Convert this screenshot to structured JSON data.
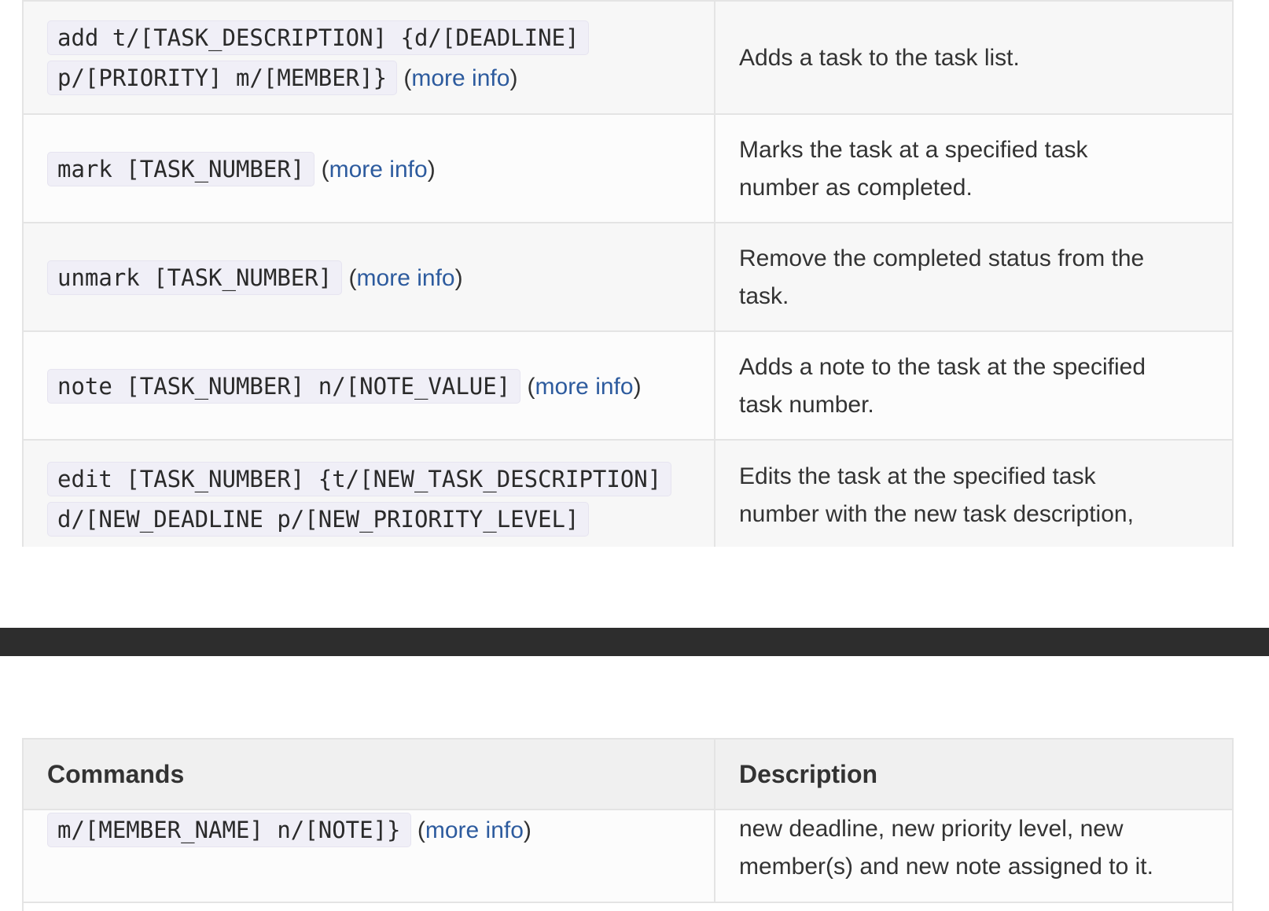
{
  "top_table": {
    "rows": [
      {
        "command_line1": "add t/[TASK_DESCRIPTION] {d/[DEADLINE]",
        "command_line2": "p/[PRIORITY] m/[MEMBER]}",
        "link": "more info",
        "description": "Adds a task to the task list."
      },
      {
        "command": "mark [TASK_NUMBER]",
        "link": "more info",
        "description_line1": "Marks the task at a specified task",
        "description_line2": "number as completed."
      },
      {
        "command": "unmark [TASK_NUMBER]",
        "link": "more info",
        "description_line1": "Remove the completed status from the",
        "description_line2": "task."
      },
      {
        "command": "note [TASK_NUMBER] n/[NOTE_VALUE]",
        "link": "more info",
        "description_line1": "Adds a note to the task at the specified",
        "description_line2": "task number."
      },
      {
        "command_line1": "edit [TASK_NUMBER] {t/[NEW_TASK_DESCRIPTION]",
        "command_line2": "d/[NEW_DEADLINE p/[NEW_PRIORITY_LEVEL]",
        "description_line1": "Edits the task at the specified task",
        "description_line2": "number with the new task description,"
      }
    ]
  },
  "bottom_table": {
    "headers": [
      "Commands",
      "Description"
    ],
    "continued_row": {
      "command": "m/[MEMBER_NAME] n/[NOTE]}",
      "link": "more info",
      "description_line1": "new deadline, new priority level, new",
      "description_line2": "member(s) and new note assigned to it."
    }
  },
  "colors": {
    "link": "#2d5b9e",
    "page_break_bar": "#2d2d2d",
    "code_background": "#f0eff7"
  }
}
